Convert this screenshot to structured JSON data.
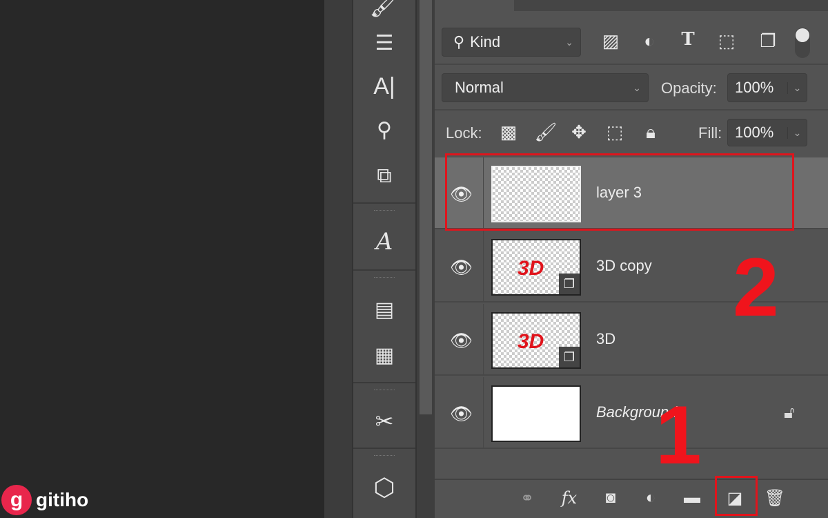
{
  "filter": {
    "kind_label": "Kind",
    "icons": [
      "image-filter-icon",
      "adjustment-filter-icon",
      "type-filter-icon",
      "shape-filter-icon",
      "smart-object-filter-icon",
      "filter-toggle"
    ]
  },
  "blend": {
    "mode": "Normal",
    "opacity_label": "Opacity:",
    "opacity": "100%"
  },
  "lock": {
    "label": "Lock:",
    "fill_label": "Fill:",
    "fill": "100%"
  },
  "layers": [
    {
      "name": "layer 3",
      "selected": true,
      "thumb_text": ""
    },
    {
      "name": "3D copy",
      "selected": false,
      "thumb_text": "3D"
    },
    {
      "name": "3D",
      "selected": false,
      "thumb_text": "3D"
    },
    {
      "name": "Background",
      "selected": false,
      "locked": true
    }
  ],
  "annotations": {
    "step1": "1",
    "step2": "2",
    "color": "#e0141c"
  },
  "footer": {
    "fx": "fx"
  },
  "tools": {
    "type_tool": "A|",
    "glyph_tool": "A"
  },
  "logo": {
    "text": "gitiho",
    "letter": "g"
  }
}
